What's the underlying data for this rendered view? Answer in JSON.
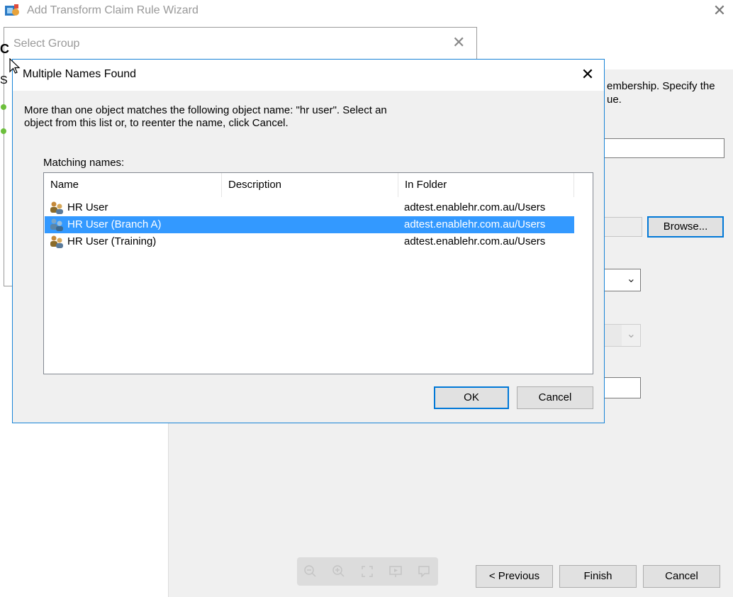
{
  "wizard": {
    "title": "Add Transform Claim Rule Wizard",
    "close_glyph": "✕",
    "description_line1": "embership. Specify the",
    "description_line2": "ue.",
    "browse_label": "Browse...",
    "previous_label": "< Previous",
    "finish_label": "Finish",
    "cancel_label": "Cancel"
  },
  "select_group": {
    "title": "Select Group",
    "close_glyph": "✕",
    "left_edge_letter": "C",
    "left_edge_letter2": "S"
  },
  "multiple_names_dialog": {
    "title": "Multiple Names Found",
    "close_glyph": "✕",
    "message_line1": "More than one object matches the following object name: \"hr user\". Select an",
    "message_line2": "object from this list or, to reenter the name, click Cancel.",
    "matching_label": "Matching names:",
    "columns": [
      "Name",
      "Description",
      "In Folder"
    ],
    "rows": [
      {
        "name": "HR User",
        "description": "",
        "folder": "adtest.enablehr.com.au/Users",
        "selected": false
      },
      {
        "name": "HR User (Branch A)",
        "description": "",
        "folder": "adtest.enablehr.com.au/Users",
        "selected": true
      },
      {
        "name": "HR User (Training)",
        "description": "",
        "folder": "adtest.enablehr.com.au/Users",
        "selected": false
      }
    ],
    "ok_label": "OK",
    "cancel_label": "Cancel"
  },
  "icons": {
    "group_icon": "group-users-icon",
    "wizard_icon": "claim-rule-icon"
  },
  "colors": {
    "selection": "#3399ff",
    "focus_border": "#0078d7"
  }
}
